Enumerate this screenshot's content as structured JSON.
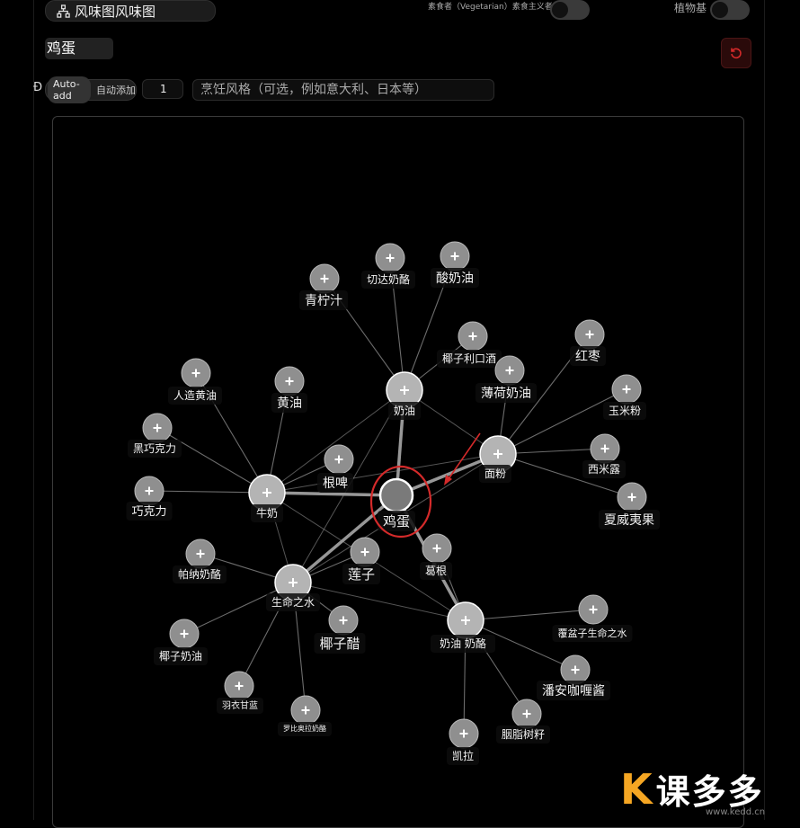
{
  "header": {
    "title": "风味图风味图",
    "vegetarian_label": "素食者（Vegetarian）素食主义者",
    "plant_based_label": "植物基"
  },
  "ingredient": {
    "name": "鸡蛋"
  },
  "controls": {
    "d_mark": "Ð",
    "auto_add_label": "Auto-add",
    "auto_add_cn": "自动添加",
    "count_value": "1",
    "style_placeholder": "烹饪风格（可选，例如意大利、日本等）"
  },
  "graph": {
    "center": {
      "label": "鸡蛋"
    },
    "hubs": [
      {
        "id": "cream",
        "label": "奶油"
      },
      {
        "id": "milk",
        "label": "牛奶"
      },
      {
        "id": "flour",
        "label": "面粉"
      },
      {
        "id": "water",
        "label": "生命之水"
      },
      {
        "id": "cc",
        "label": "奶油 奶酪"
      }
    ],
    "nodes": [
      {
        "label": "切达奶酪"
      },
      {
        "label": "酸奶油"
      },
      {
        "label": "青柠汁"
      },
      {
        "label": "椰子利口酒"
      },
      {
        "label": "薄荷奶油"
      },
      {
        "label": "红枣"
      },
      {
        "label": "人造黄油"
      },
      {
        "label": "黄油"
      },
      {
        "label": "玉米粉"
      },
      {
        "label": "黑巧克力"
      },
      {
        "label": "根啤"
      },
      {
        "label": "西米露"
      },
      {
        "label": "巧克力"
      },
      {
        "label": "夏威夷果"
      },
      {
        "label": "莲子"
      },
      {
        "label": "葛根"
      },
      {
        "label": "帕纳奶酪"
      },
      {
        "label": "椰子醋"
      },
      {
        "label": "覆盆子生命之水"
      },
      {
        "label": "椰子奶油"
      },
      {
        "label": "潘安咖喱酱"
      },
      {
        "label": "羽衣甘蓝"
      },
      {
        "label": "罗比奥拉奶酪"
      },
      {
        "label": "胭脂树籽"
      },
      {
        "label": "凯拉"
      }
    ]
  },
  "watermark": {
    "brand": "课多多",
    "url": "www.kedd.cn"
  },
  "colors": {
    "accent_red": "#d42a2a",
    "node_fill": "#8a8a8a",
    "edge": "#9a9a9a"
  }
}
